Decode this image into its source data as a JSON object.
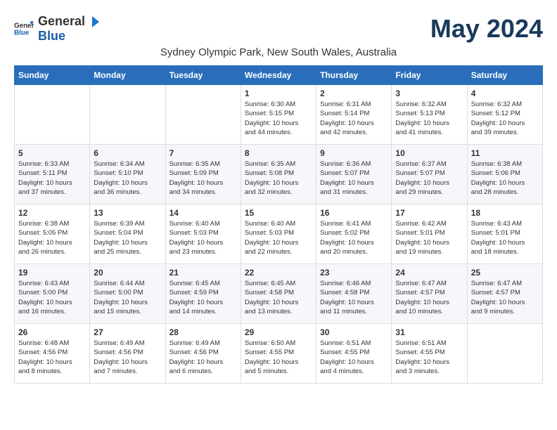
{
  "header": {
    "logo_general": "General",
    "logo_blue": "Blue",
    "month_year": "May 2024",
    "location": "Sydney Olympic Park, New South Wales, Australia"
  },
  "days_of_week": [
    "Sunday",
    "Monday",
    "Tuesday",
    "Wednesday",
    "Thursday",
    "Friday",
    "Saturday"
  ],
  "weeks": [
    [
      {
        "day": "",
        "info": ""
      },
      {
        "day": "",
        "info": ""
      },
      {
        "day": "",
        "info": ""
      },
      {
        "day": "1",
        "info": "Sunrise: 6:30 AM\nSunset: 5:15 PM\nDaylight: 10 hours\nand 44 minutes."
      },
      {
        "day": "2",
        "info": "Sunrise: 6:31 AM\nSunset: 5:14 PM\nDaylight: 10 hours\nand 42 minutes."
      },
      {
        "day": "3",
        "info": "Sunrise: 6:32 AM\nSunset: 5:13 PM\nDaylight: 10 hours\nand 41 minutes."
      },
      {
        "day": "4",
        "info": "Sunrise: 6:32 AM\nSunset: 5:12 PM\nDaylight: 10 hours\nand 39 minutes."
      }
    ],
    [
      {
        "day": "5",
        "info": "Sunrise: 6:33 AM\nSunset: 5:11 PM\nDaylight: 10 hours\nand 37 minutes."
      },
      {
        "day": "6",
        "info": "Sunrise: 6:34 AM\nSunset: 5:10 PM\nDaylight: 10 hours\nand 36 minutes."
      },
      {
        "day": "7",
        "info": "Sunrise: 6:35 AM\nSunset: 5:09 PM\nDaylight: 10 hours\nand 34 minutes."
      },
      {
        "day": "8",
        "info": "Sunrise: 6:35 AM\nSunset: 5:08 PM\nDaylight: 10 hours\nand 32 minutes."
      },
      {
        "day": "9",
        "info": "Sunrise: 6:36 AM\nSunset: 5:07 PM\nDaylight: 10 hours\nand 31 minutes."
      },
      {
        "day": "10",
        "info": "Sunrise: 6:37 AM\nSunset: 5:07 PM\nDaylight: 10 hours\nand 29 minutes."
      },
      {
        "day": "11",
        "info": "Sunrise: 6:38 AM\nSunset: 5:06 PM\nDaylight: 10 hours\nand 28 minutes."
      }
    ],
    [
      {
        "day": "12",
        "info": "Sunrise: 6:38 AM\nSunset: 5:05 PM\nDaylight: 10 hours\nand 26 minutes."
      },
      {
        "day": "13",
        "info": "Sunrise: 6:39 AM\nSunset: 5:04 PM\nDaylight: 10 hours\nand 25 minutes."
      },
      {
        "day": "14",
        "info": "Sunrise: 6:40 AM\nSunset: 5:03 PM\nDaylight: 10 hours\nand 23 minutes."
      },
      {
        "day": "15",
        "info": "Sunrise: 6:40 AM\nSunset: 5:03 PM\nDaylight: 10 hours\nand 22 minutes."
      },
      {
        "day": "16",
        "info": "Sunrise: 6:41 AM\nSunset: 5:02 PM\nDaylight: 10 hours\nand 20 minutes."
      },
      {
        "day": "17",
        "info": "Sunrise: 6:42 AM\nSunset: 5:01 PM\nDaylight: 10 hours\nand 19 minutes."
      },
      {
        "day": "18",
        "info": "Sunrise: 6:43 AM\nSunset: 5:01 PM\nDaylight: 10 hours\nand 18 minutes."
      }
    ],
    [
      {
        "day": "19",
        "info": "Sunrise: 6:43 AM\nSunset: 5:00 PM\nDaylight: 10 hours\nand 16 minutes."
      },
      {
        "day": "20",
        "info": "Sunrise: 6:44 AM\nSunset: 5:00 PM\nDaylight: 10 hours\nand 15 minutes."
      },
      {
        "day": "21",
        "info": "Sunrise: 6:45 AM\nSunset: 4:59 PM\nDaylight: 10 hours\nand 14 minutes."
      },
      {
        "day": "22",
        "info": "Sunrise: 6:45 AM\nSunset: 4:58 PM\nDaylight: 10 hours\nand 13 minutes."
      },
      {
        "day": "23",
        "info": "Sunrise: 6:46 AM\nSunset: 4:58 PM\nDaylight: 10 hours\nand 11 minutes."
      },
      {
        "day": "24",
        "info": "Sunrise: 6:47 AM\nSunset: 4:57 PM\nDaylight: 10 hours\nand 10 minutes."
      },
      {
        "day": "25",
        "info": "Sunrise: 6:47 AM\nSunset: 4:57 PM\nDaylight: 10 hours\nand 9 minutes."
      }
    ],
    [
      {
        "day": "26",
        "info": "Sunrise: 6:48 AM\nSunset: 4:56 PM\nDaylight: 10 hours\nand 8 minutes."
      },
      {
        "day": "27",
        "info": "Sunrise: 6:49 AM\nSunset: 4:56 PM\nDaylight: 10 hours\nand 7 minutes."
      },
      {
        "day": "28",
        "info": "Sunrise: 6:49 AM\nSunset: 4:56 PM\nDaylight: 10 hours\nand 6 minutes."
      },
      {
        "day": "29",
        "info": "Sunrise: 6:50 AM\nSunset: 4:55 PM\nDaylight: 10 hours\nand 5 minutes."
      },
      {
        "day": "30",
        "info": "Sunrise: 6:51 AM\nSunset: 4:55 PM\nDaylight: 10 hours\nand 4 minutes."
      },
      {
        "day": "31",
        "info": "Sunrise: 6:51 AM\nSunset: 4:55 PM\nDaylight: 10 hours\nand 3 minutes."
      },
      {
        "day": "",
        "info": ""
      }
    ]
  ]
}
